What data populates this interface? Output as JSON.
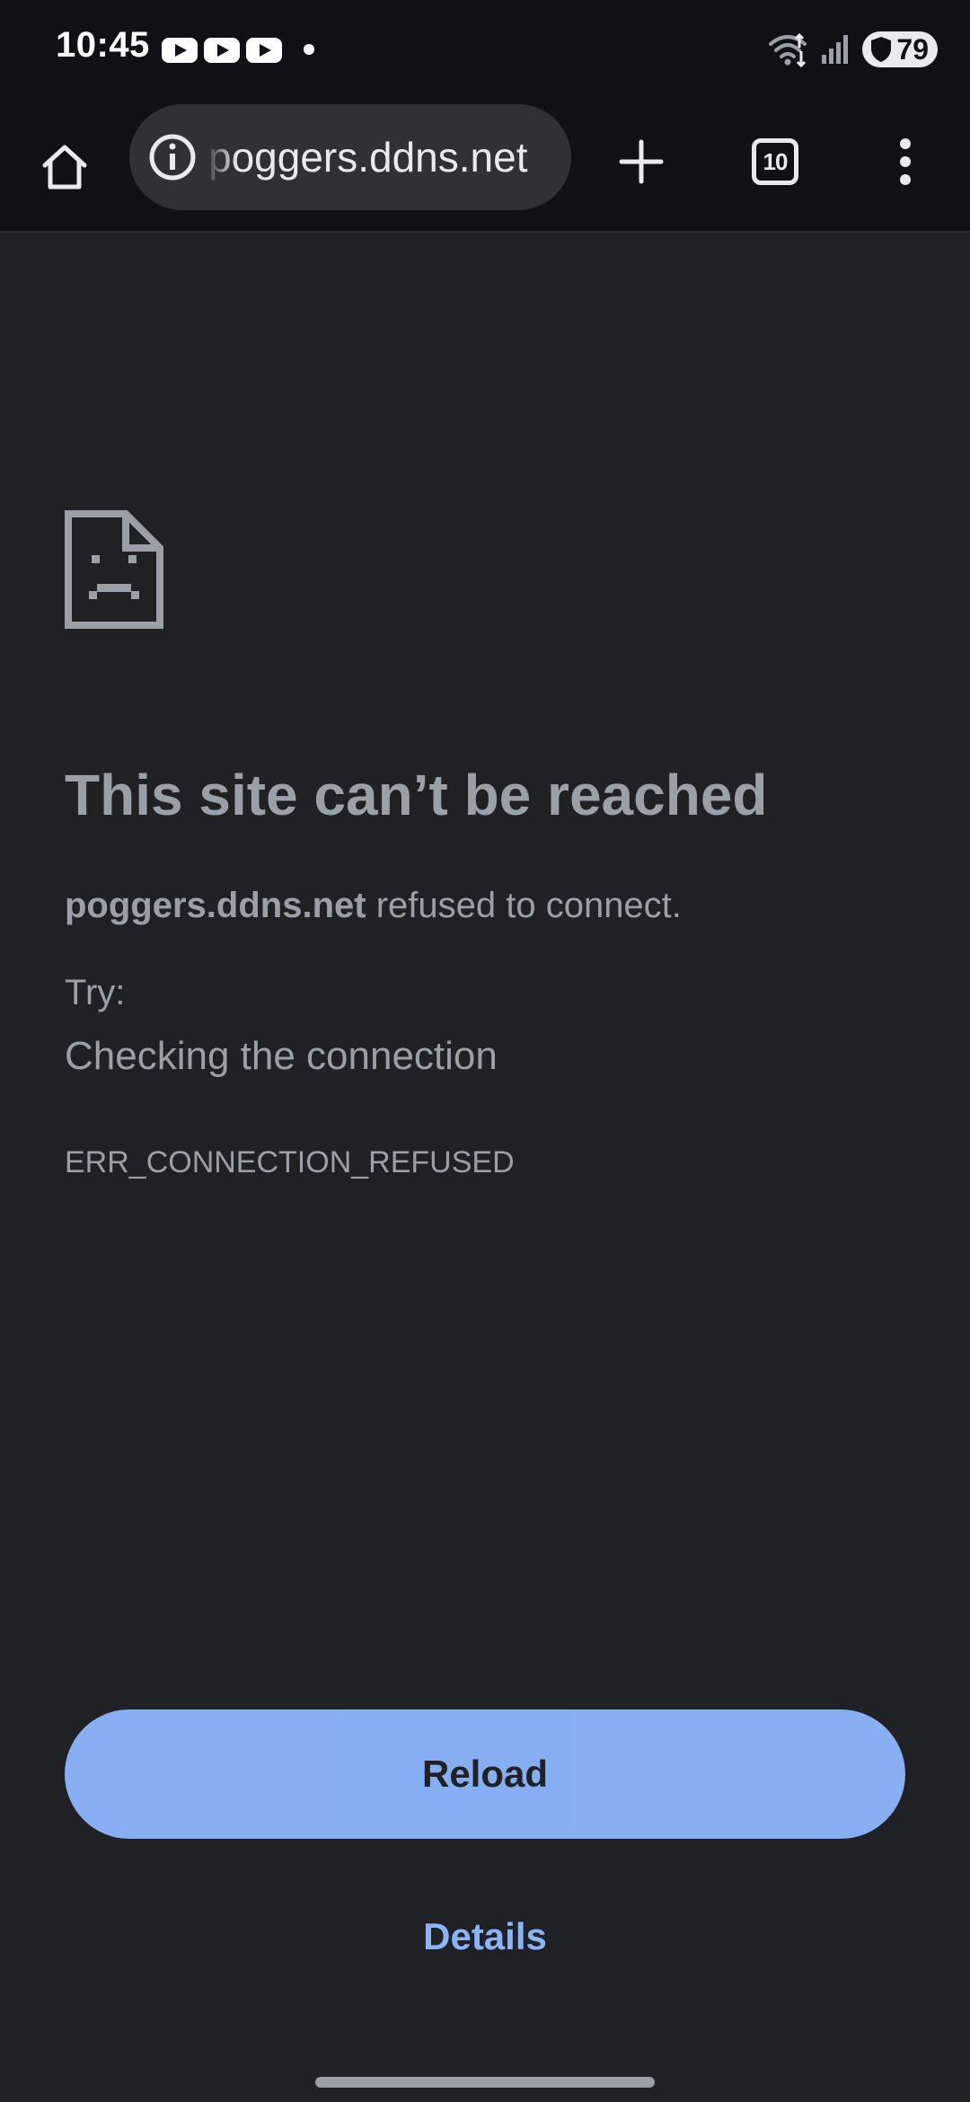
{
  "status_bar": {
    "time": "10:45",
    "notification_icons": [
      "youtube-icon",
      "youtube-icon",
      "youtube-icon",
      "dot-icon"
    ],
    "battery_level": "79",
    "system_icons": [
      "wifi-icon",
      "signal-icon",
      "battery-shield-icon"
    ]
  },
  "toolbar": {
    "url_display": "poggers.ddns.net",
    "tab_count": "10",
    "icons": [
      "home-icon",
      "info-icon",
      "plus-icon",
      "tab-switcher-icon",
      "more-vert-icon"
    ]
  },
  "error": {
    "icon": "sad-page-icon",
    "title": "This site can’t be reached",
    "host": "poggers.ddns.net",
    "message_suffix": " refused to connect.",
    "try_label": "Try:",
    "suggestion": "Checking the connection",
    "code": "ERR_CONNECTION_REFUSED"
  },
  "actions": {
    "reload_label": "Reload",
    "details_label": "Details"
  },
  "colors": {
    "chrome_bg": "#0f1115",
    "page_bg": "#202124",
    "omnibox_bg": "#303134",
    "text_muted": "#9aa0a6",
    "accent": "#8ab4f8"
  }
}
